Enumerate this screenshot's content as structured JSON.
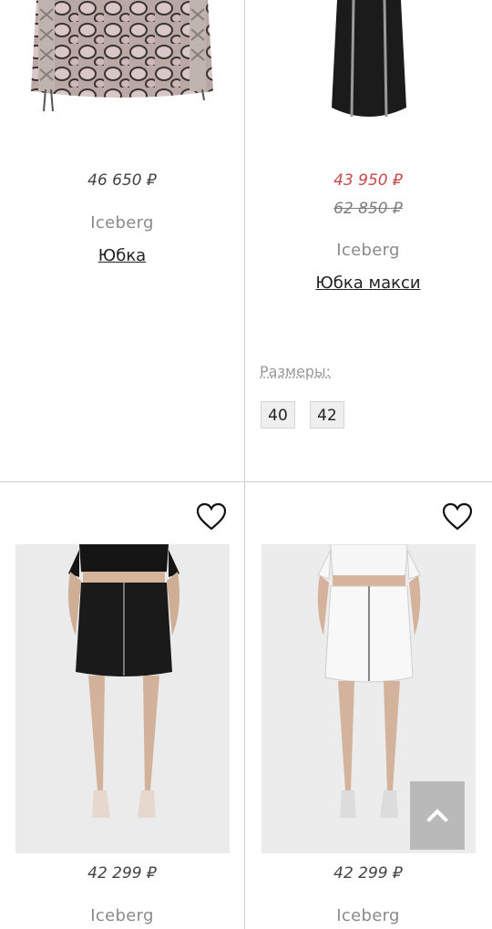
{
  "products": [
    {
      "price": "46 650 ₽",
      "brand": "Iceberg",
      "title": "Юбка"
    },
    {
      "price_sale": "43 950 ₽",
      "price_old": "62 850 ₽",
      "brand": "Iceberg",
      "title": "Юбка макси",
      "sizes_label": "Размеры:",
      "sizes": [
        "40",
        "42"
      ]
    },
    {
      "price": "42 299 ₽",
      "brand": "Iceberg"
    },
    {
      "price": "42 299 ₽",
      "brand": "Iceberg"
    }
  ],
  "icons": {
    "favorite": "heart-icon",
    "scroll_top": "chevron-up-icon"
  },
  "colors": {
    "sale": "#c9484a",
    "divider": "#cfcfcf",
    "scroll_button": "#b9b9b9"
  }
}
